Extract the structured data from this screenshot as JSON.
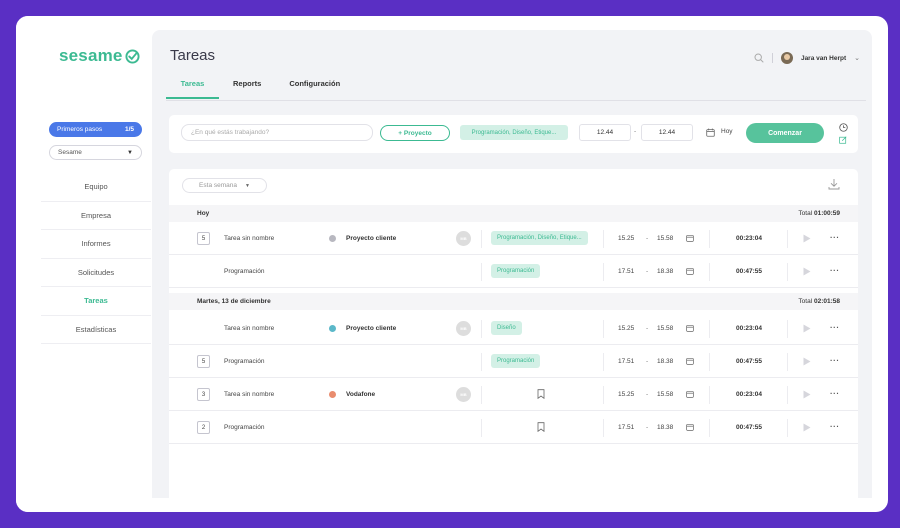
{
  "app": {
    "logo_text": "sesame",
    "brand_color": "#3cba92",
    "accent_color": "#4a78e8",
    "background_color": "#5a2fc4"
  },
  "sidebar": {
    "first_steps": {
      "label": "Primeros pasos",
      "count": "1/5"
    },
    "company_select": {
      "value": "Sesame"
    },
    "items": [
      {
        "label": "Equipo"
      },
      {
        "label": "Empresa"
      },
      {
        "label": "Informes"
      },
      {
        "label": "Solicitudes"
      },
      {
        "label": "Tareas",
        "active": true
      },
      {
        "label": "Estadísticas"
      }
    ]
  },
  "header": {
    "title": "Tareas",
    "user_name": "Jara van Herpt",
    "icons": [
      "search-icon",
      "chevron-down-icon"
    ]
  },
  "tabs": [
    {
      "label": "Tareas",
      "active": true
    },
    {
      "label": "Reports"
    },
    {
      "label": "Configuración"
    }
  ],
  "tracker": {
    "task_placeholder": "¿En qué estás trabajando?",
    "project_button": "+ Proyecto",
    "tags": "Programación, Diseño, Etique...",
    "start_time": "12.44",
    "separator": "-",
    "end_time": "12.44",
    "date_label": "Hoy",
    "start_button": "Comenzar"
  },
  "table": {
    "week_filter": "Esta semana",
    "groups": [
      {
        "title": "Hoy",
        "total_label": "Total",
        "total": "01:00:59",
        "rows": [
          {
            "count": "5",
            "task": "Tarea sin nombre",
            "project": "Proyecto cliente",
            "project_color": "#b8b8c0",
            "avatar": "MB",
            "tag": "Programación, Diseño, Etique...",
            "start": "15.25",
            "end": "15.58",
            "duration": "00:23:04"
          },
          {
            "count": "",
            "task": "Programación",
            "project": "",
            "project_color": "",
            "avatar": "",
            "tag": "Programación",
            "start": "17.51",
            "end": "18.38",
            "duration": "00:47:55"
          }
        ]
      },
      {
        "title": "Martes, 13 de diciembre",
        "total_label": "Total",
        "total": "02:01:58",
        "rows": [
          {
            "count": "",
            "task": "Tarea sin nombre",
            "project": "Proyecto cliente",
            "project_color": "#5bb8c9",
            "avatar": "MB",
            "tag": "Diseño",
            "start": "15.25",
            "end": "15.58",
            "duration": "00:23:04"
          },
          {
            "count": "5",
            "task": "Programación",
            "project": "",
            "project_color": "",
            "avatar": "",
            "tag": "Programación",
            "start": "17.51",
            "end": "18.38",
            "duration": "00:47:55"
          },
          {
            "count": "3",
            "task": "Tarea sin nombre",
            "project": "Vodafone",
            "project_color": "#e98c6e",
            "avatar": "MB",
            "tag": "",
            "start": "15.25",
            "end": "15.58",
            "duration": "00:23:04"
          },
          {
            "count": "2",
            "task": "Programación",
            "project": "",
            "project_color": "",
            "avatar": "",
            "tag": "",
            "start": "17.51",
            "end": "18.38",
            "duration": "00:47:55"
          }
        ]
      }
    ]
  }
}
